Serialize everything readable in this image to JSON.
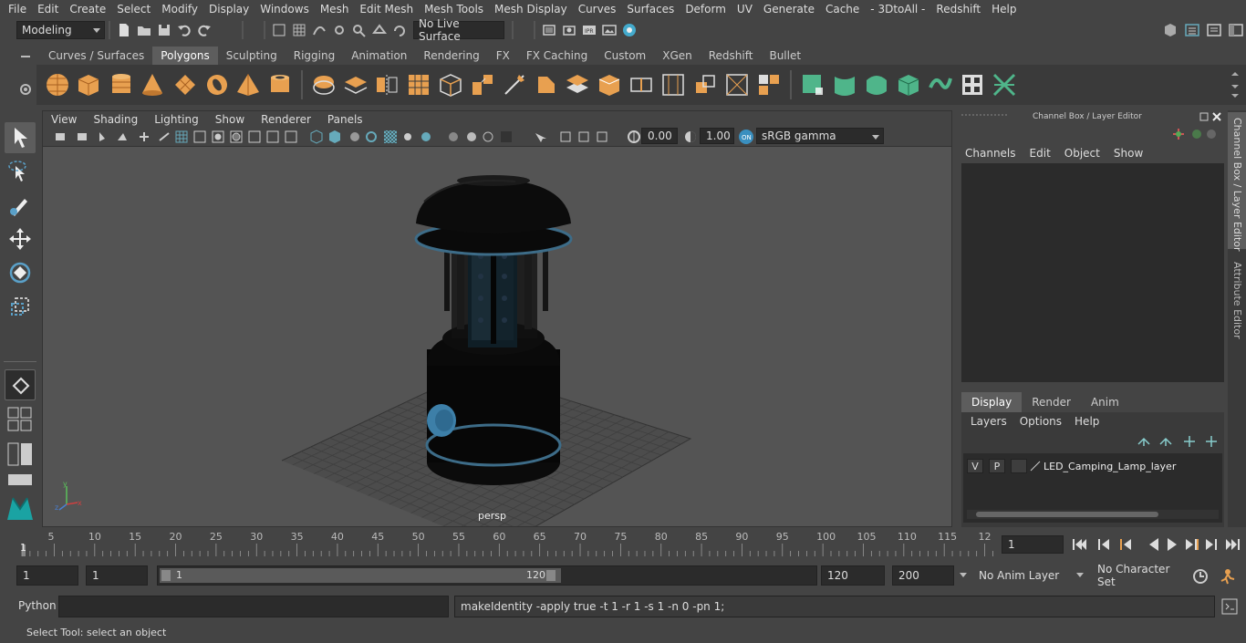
{
  "menu": [
    "File",
    "Edit",
    "Create",
    "Select",
    "Modify",
    "Display",
    "Windows",
    "Mesh",
    "Edit Mesh",
    "Mesh Tools",
    "Mesh Display",
    "Curves",
    "Surfaces",
    "Deform",
    "UV",
    "Generate",
    "Cache",
    "- 3DtoAll -",
    "Redshift",
    "Help"
  ],
  "status": {
    "mode": "Modeling",
    "live_surface": "No Live Surface"
  },
  "shelf_tabs": [
    "Curves / Surfaces",
    "Polygons",
    "Sculpting",
    "Rigging",
    "Animation",
    "Rendering",
    "FX",
    "FX Caching",
    "Custom",
    "XGen",
    "Redshift",
    "Bullet"
  ],
  "shelf_active": "Polygons",
  "viewport": {
    "menu": [
      "View",
      "Shading",
      "Lighting",
      "Show",
      "Renderer",
      "Panels"
    ],
    "exposure": "0.00",
    "gamma": "1.00",
    "colorspace": "sRGB gamma",
    "camera": "persp"
  },
  "channelbox": {
    "title": "Channel Box / Layer Editor",
    "menu": [
      "Channels",
      "Edit",
      "Object",
      "Show"
    ],
    "layer_tabs": [
      "Display",
      "Render",
      "Anim"
    ],
    "layer_menu": [
      "Layers",
      "Options",
      "Help"
    ],
    "layer": {
      "v": "V",
      "p": "P",
      "name": "LED_Camping_Lamp_layer"
    }
  },
  "side_tabs": [
    "Channel Box / Layer Editor",
    "Attribute Editor"
  ],
  "timeline": {
    "ticks": [
      "5",
      "10",
      "15",
      "20",
      "25",
      "30",
      "35",
      "40",
      "45",
      "50",
      "55",
      "60",
      "65",
      "70",
      "75",
      "80",
      "85",
      "90",
      "95",
      "100",
      "105",
      "110",
      "115",
      "12"
    ],
    "start_label": "1",
    "current_frame": "1"
  },
  "range": {
    "start": "1",
    "playback_start": "1",
    "slider_start": "1",
    "slider_end": "120",
    "playback_end": "120",
    "end": "200",
    "anim_layer": "No Anim Layer",
    "character_set": "No Character Set"
  },
  "cmd": {
    "label": "Python",
    "output": "makeIdentity -apply true -t 1 -r 1 -s 1 -n 0 -pn 1;"
  },
  "help": "Select Tool: select an object",
  "colors": {
    "accent": "#5285a6",
    "shelf_orange": "#e8a050",
    "shelf_green": "#4fb58a"
  }
}
